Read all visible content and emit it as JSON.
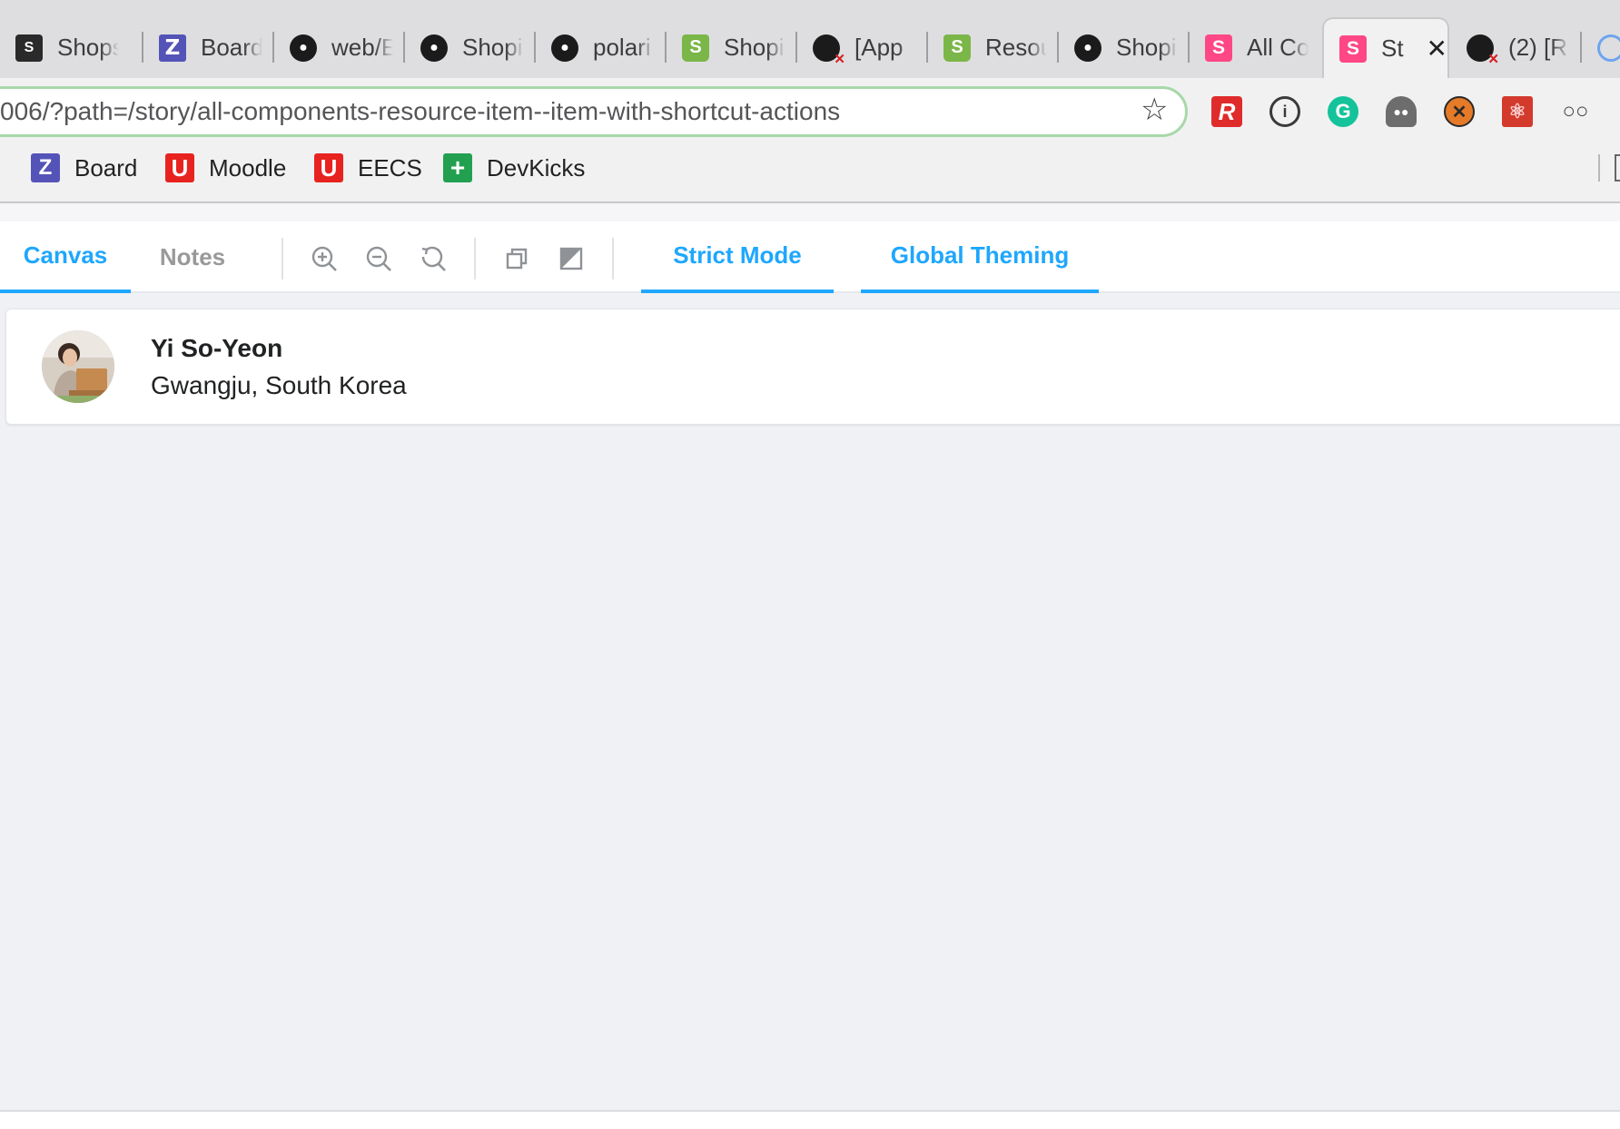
{
  "browser": {
    "tabs": [
      {
        "title": "Shops",
        "icon": "shopify-icon"
      },
      {
        "title": "Board",
        "icon": "zenhub-icon"
      },
      {
        "title": "web/E",
        "icon": "github-icon"
      },
      {
        "title": "Shopi",
        "icon": "github-icon"
      },
      {
        "title": "polari",
        "icon": "github-icon"
      },
      {
        "title": "Shopi",
        "icon": "shopify-icon"
      },
      {
        "title": "[App",
        "icon": "github-error-icon"
      },
      {
        "title": "Resou",
        "icon": "shopify-icon"
      },
      {
        "title": "Shopi",
        "icon": "github-icon"
      },
      {
        "title": "All Co",
        "icon": "storybook-icon"
      },
      {
        "title": "St",
        "icon": "storybook-icon",
        "active": true
      },
      {
        "title": "(2) [R",
        "icon": "github-error-icon"
      }
    ],
    "url": "006/?path=/story/all-components-resource-item--item-with-shortcut-actions",
    "extensions": [
      "R",
      "1password-icon",
      "grammarly-icon",
      "ghost-icon",
      "x-icon",
      "react-icon",
      "glasses-icon"
    ],
    "bookmarks": [
      {
        "label": "Board",
        "icon": "zenhub-icon"
      },
      {
        "label": "Moodle",
        "icon": "umich-icon"
      },
      {
        "label": "EECS",
        "icon": "umich-icon"
      },
      {
        "label": "DevKicks",
        "icon": "devkicks-icon"
      }
    ]
  },
  "storybook": {
    "tabs": {
      "canvas": "Canvas",
      "notes": "Notes"
    },
    "addons": {
      "strict_mode": "Strict Mode",
      "global_theming": "Global Theming"
    },
    "accent": "#1ea7fd"
  },
  "resource_item": {
    "name": "Yi So-Yeon",
    "location": "Gwangju, South Korea"
  }
}
